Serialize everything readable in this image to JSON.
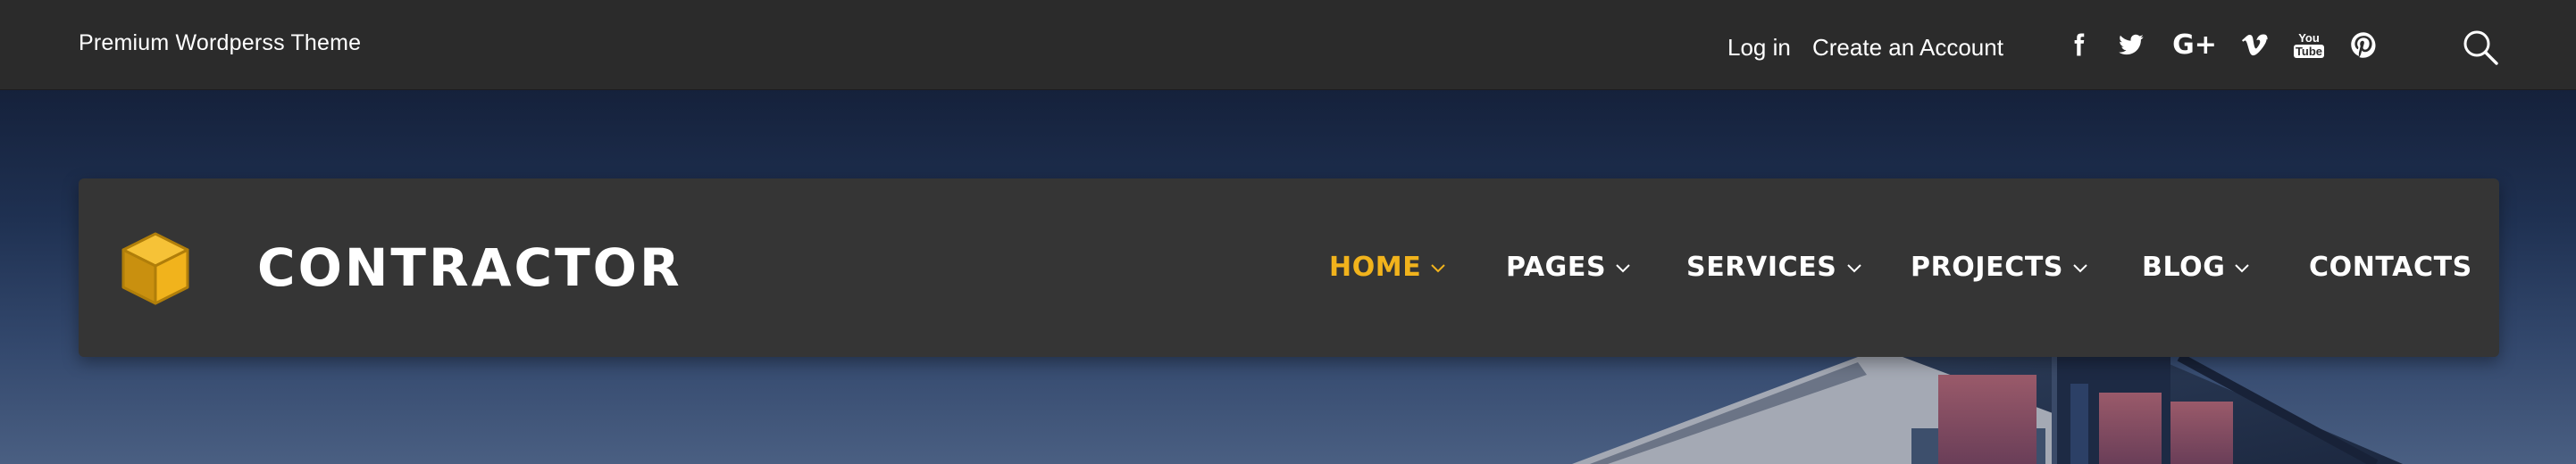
{
  "topbar": {
    "tagline": "Premium Wordperss Theme",
    "login_label": "Log in",
    "create_account_label": "Create an Account",
    "social_icons": [
      "facebook-icon",
      "twitter-icon",
      "google-plus-icon",
      "vimeo-icon",
      "youtube-icon",
      "pinterest-icon"
    ],
    "youtube_text_top": "You",
    "youtube_text_bottom": "Tube",
    "google_plus_text": "G+"
  },
  "nav": {
    "brand": "CONTRACTOR",
    "items": [
      {
        "label": "HOME",
        "active": true,
        "has_dropdown": true
      },
      {
        "label": "PAGES",
        "active": false,
        "has_dropdown": true
      },
      {
        "label": "SERVICES",
        "active": false,
        "has_dropdown": true
      },
      {
        "label": "PROJECTS",
        "active": false,
        "has_dropdown": true
      },
      {
        "label": "BLOG",
        "active": false,
        "has_dropdown": true
      },
      {
        "label": "CONTACTS",
        "active": false,
        "has_dropdown": false
      }
    ]
  },
  "colors": {
    "accent": "#f1b31c",
    "topbar_bg": "#2b2b2b",
    "navcard_bg": "#353535",
    "text": "#ffffff"
  }
}
